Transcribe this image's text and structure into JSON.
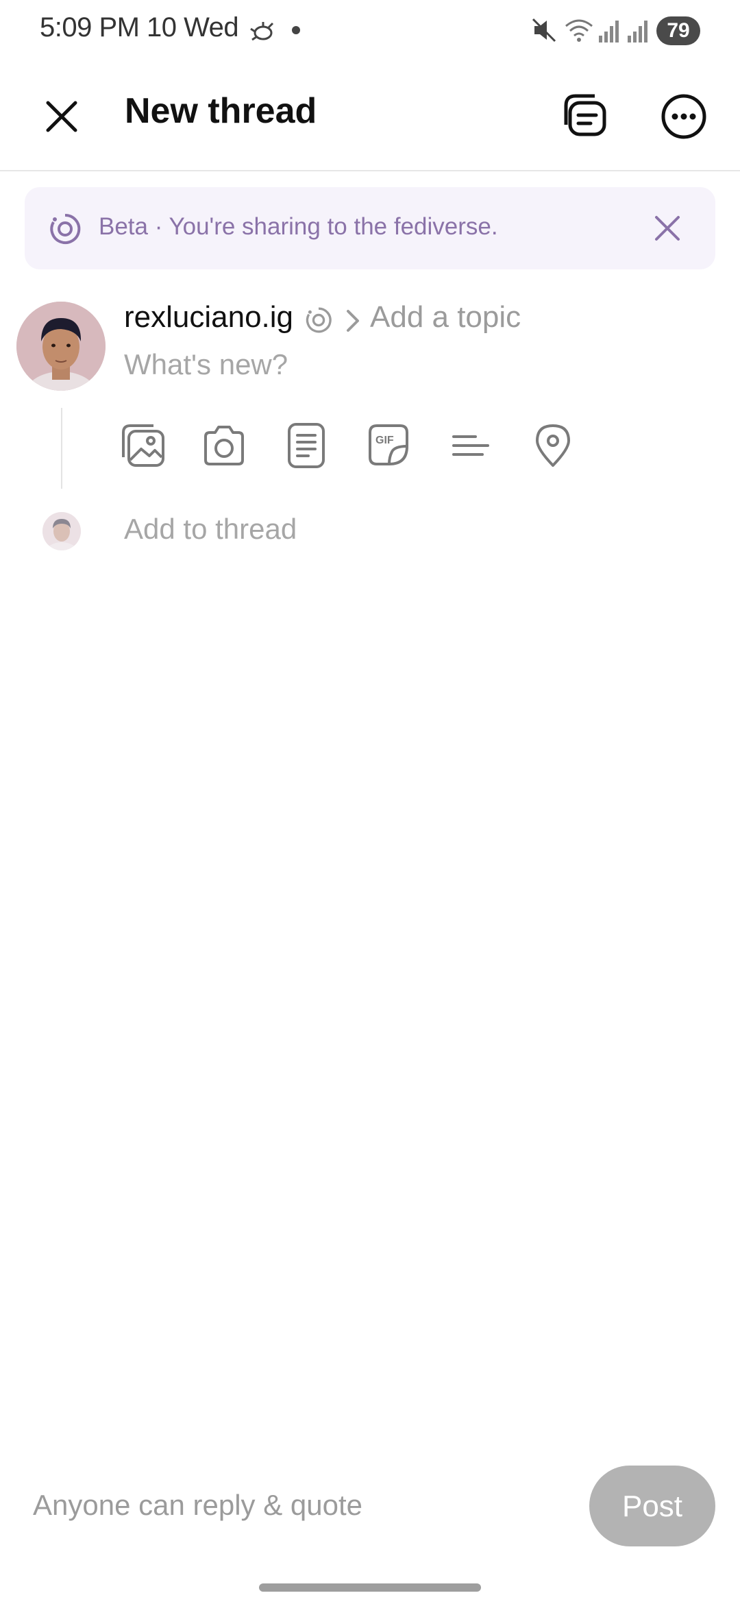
{
  "status_bar": {
    "time": "5:09 PM",
    "date": "10 Wed",
    "battery": "79"
  },
  "header": {
    "title": "New thread"
  },
  "banner": {
    "text": "Beta · You're sharing to the fediverse."
  },
  "compose": {
    "username": "rexluciano.ig",
    "topic_placeholder": "Add a topic",
    "text_placeholder": "What's new?",
    "add_to_thread": "Add to thread"
  },
  "toolbar": {
    "icons": [
      "gallery-icon",
      "camera-icon",
      "document-icon",
      "gif-icon",
      "text-align-icon",
      "location-icon"
    ]
  },
  "footer": {
    "reply_setting": "Anyone can reply & quote",
    "post_label": "Post"
  },
  "colors": {
    "banner_bg": "#f6f3fb",
    "banner_text": "#8a72a8",
    "post_button": "#b3b3b3"
  }
}
